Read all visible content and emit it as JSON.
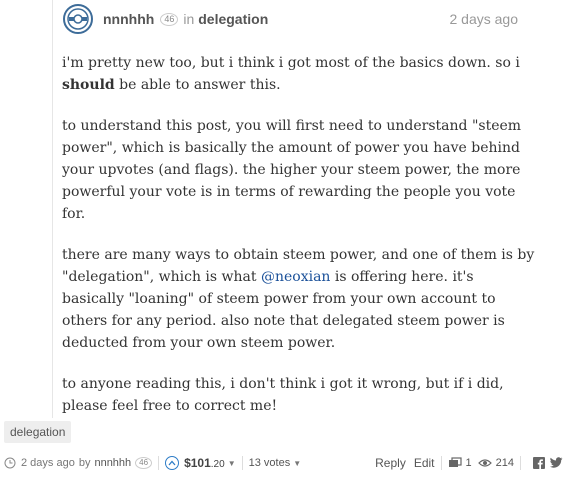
{
  "post": {
    "author": "nnnhhh",
    "reputation": "46",
    "in_word": "in",
    "category": "delegation",
    "timestamp": "2 days ago",
    "paragraphs": {
      "p1_a": "i'm pretty new too, but i think i got most of the basics down. so i ",
      "p1_bold": "should",
      "p1_b": " be able to answer this.",
      "p2": "to understand this post, you will first need to understand \"steem power\", which is basically the amount of power you have behind your upvotes (and flags). the higher your steem power, the more powerful your vote is in terms of rewarding the people you vote for.",
      "p3_a": "there are many ways to obtain steem power, and one of them is by \"delegation\", which is what ",
      "p3_mention": "@neoxian",
      "p3_b": " is offering here. it's basically \"loaning\" of steem power from your own account to others for any period. also note that delegated steem power is deducted from your own steem power.",
      "p4": "to anyone reading this, i don't think i got it wrong, but if i did, please feel free to correct me!"
    },
    "tag": "delegation"
  },
  "footer": {
    "ago": "2 days ago",
    "by": "by",
    "author": "nnnhhh",
    "reputation": "46",
    "payout_main": "$101",
    "payout_cents": ".20",
    "votes": "13 votes",
    "reply": "Reply",
    "edit": "Edit",
    "reblogs": "1",
    "views": "214"
  },
  "icons": {
    "avatar": "avatar-logo-icon",
    "clock": "clock-icon",
    "upvote": "upvote-chevron-icon",
    "reblog": "reblog-icon",
    "views": "eye-icon",
    "facebook": "facebook-icon",
    "twitter": "twitter-icon"
  },
  "colors": {
    "link": "#1a5099",
    "upvote": "#2d7cc7",
    "avatar_ring": "#3d6c99"
  }
}
